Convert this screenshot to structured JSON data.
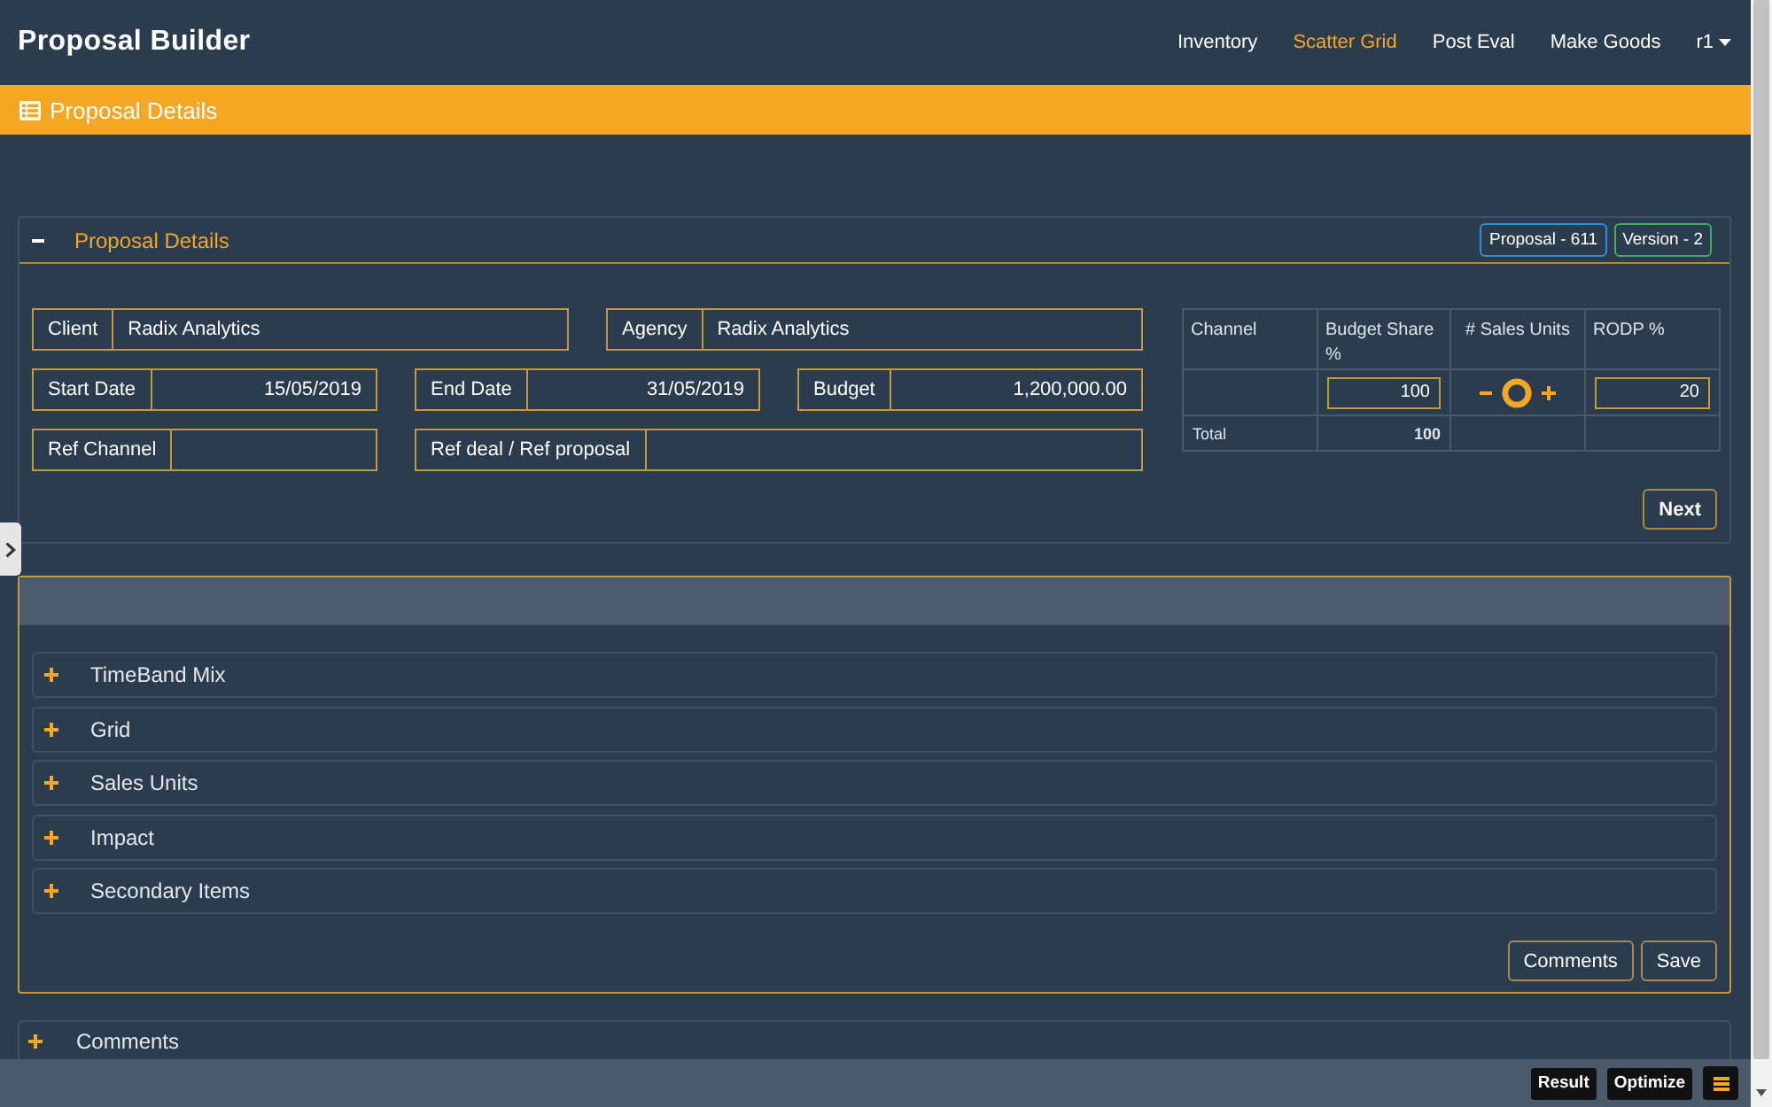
{
  "app": {
    "title": "Proposal Builder"
  },
  "nav": {
    "items": [
      {
        "label": "Inventory",
        "selected": false
      },
      {
        "label": "Scatter Grid",
        "selected": true
      },
      {
        "label": "Post Eval",
        "selected": false
      },
      {
        "label": "Make Goods",
        "selected": false
      }
    ],
    "user_menu": "r1"
  },
  "banner": {
    "title": "Proposal Details"
  },
  "details_panel": {
    "title": "Proposal Details",
    "expanded": true,
    "badges": [
      {
        "label": "Proposal - 611",
        "color": "#2f8fd5"
      },
      {
        "label": "Version - 2",
        "color": "#3fae5f"
      }
    ],
    "field_rows": [
      [
        {
          "label": "Client",
          "value": "Radix Analytics",
          "kind": "text"
        },
        {
          "label": "Agency",
          "value": "Radix Analytics",
          "kind": "text"
        }
      ],
      [
        {
          "label": "Start Date",
          "value": "15/05/2019",
          "kind": "date"
        },
        {
          "label": "End Date",
          "value": "31/05/2019",
          "kind": "date"
        },
        {
          "label": "Budget",
          "value": "1,200,000.00",
          "kind": "amount"
        }
      ],
      [
        {
          "label": "Ref Channel",
          "kind": "text"
        },
        {
          "label": "Ref deal / Ref proposal",
          "kind": "text"
        }
      ]
    ],
    "channel_table": {
      "columns": [
        "Channel",
        "Budget Share %",
        "# Sales Units",
        "RODP %"
      ],
      "rows": [
        {
          "budget_share": "100",
          "rodp": "20"
        }
      ],
      "total": {
        "label": "Total",
        "budget_share": "100"
      }
    },
    "buttons": [
      "Next"
    ]
  },
  "sections_panel": {
    "sections": [
      {
        "label": "TimeBand Mix",
        "expanded": false
      },
      {
        "label": "Grid",
        "expanded": false
      },
      {
        "label": "Sales Units",
        "expanded": false
      },
      {
        "label": "Impact",
        "expanded": false
      },
      {
        "label": "Secondary Items",
        "expanded": false
      }
    ],
    "buttons": [
      "Comments",
      "Save"
    ]
  },
  "comments_panel": {
    "title": "Comments",
    "expanded": false
  },
  "footer": {
    "buttons": [
      "Result",
      "Optimize"
    ]
  }
}
